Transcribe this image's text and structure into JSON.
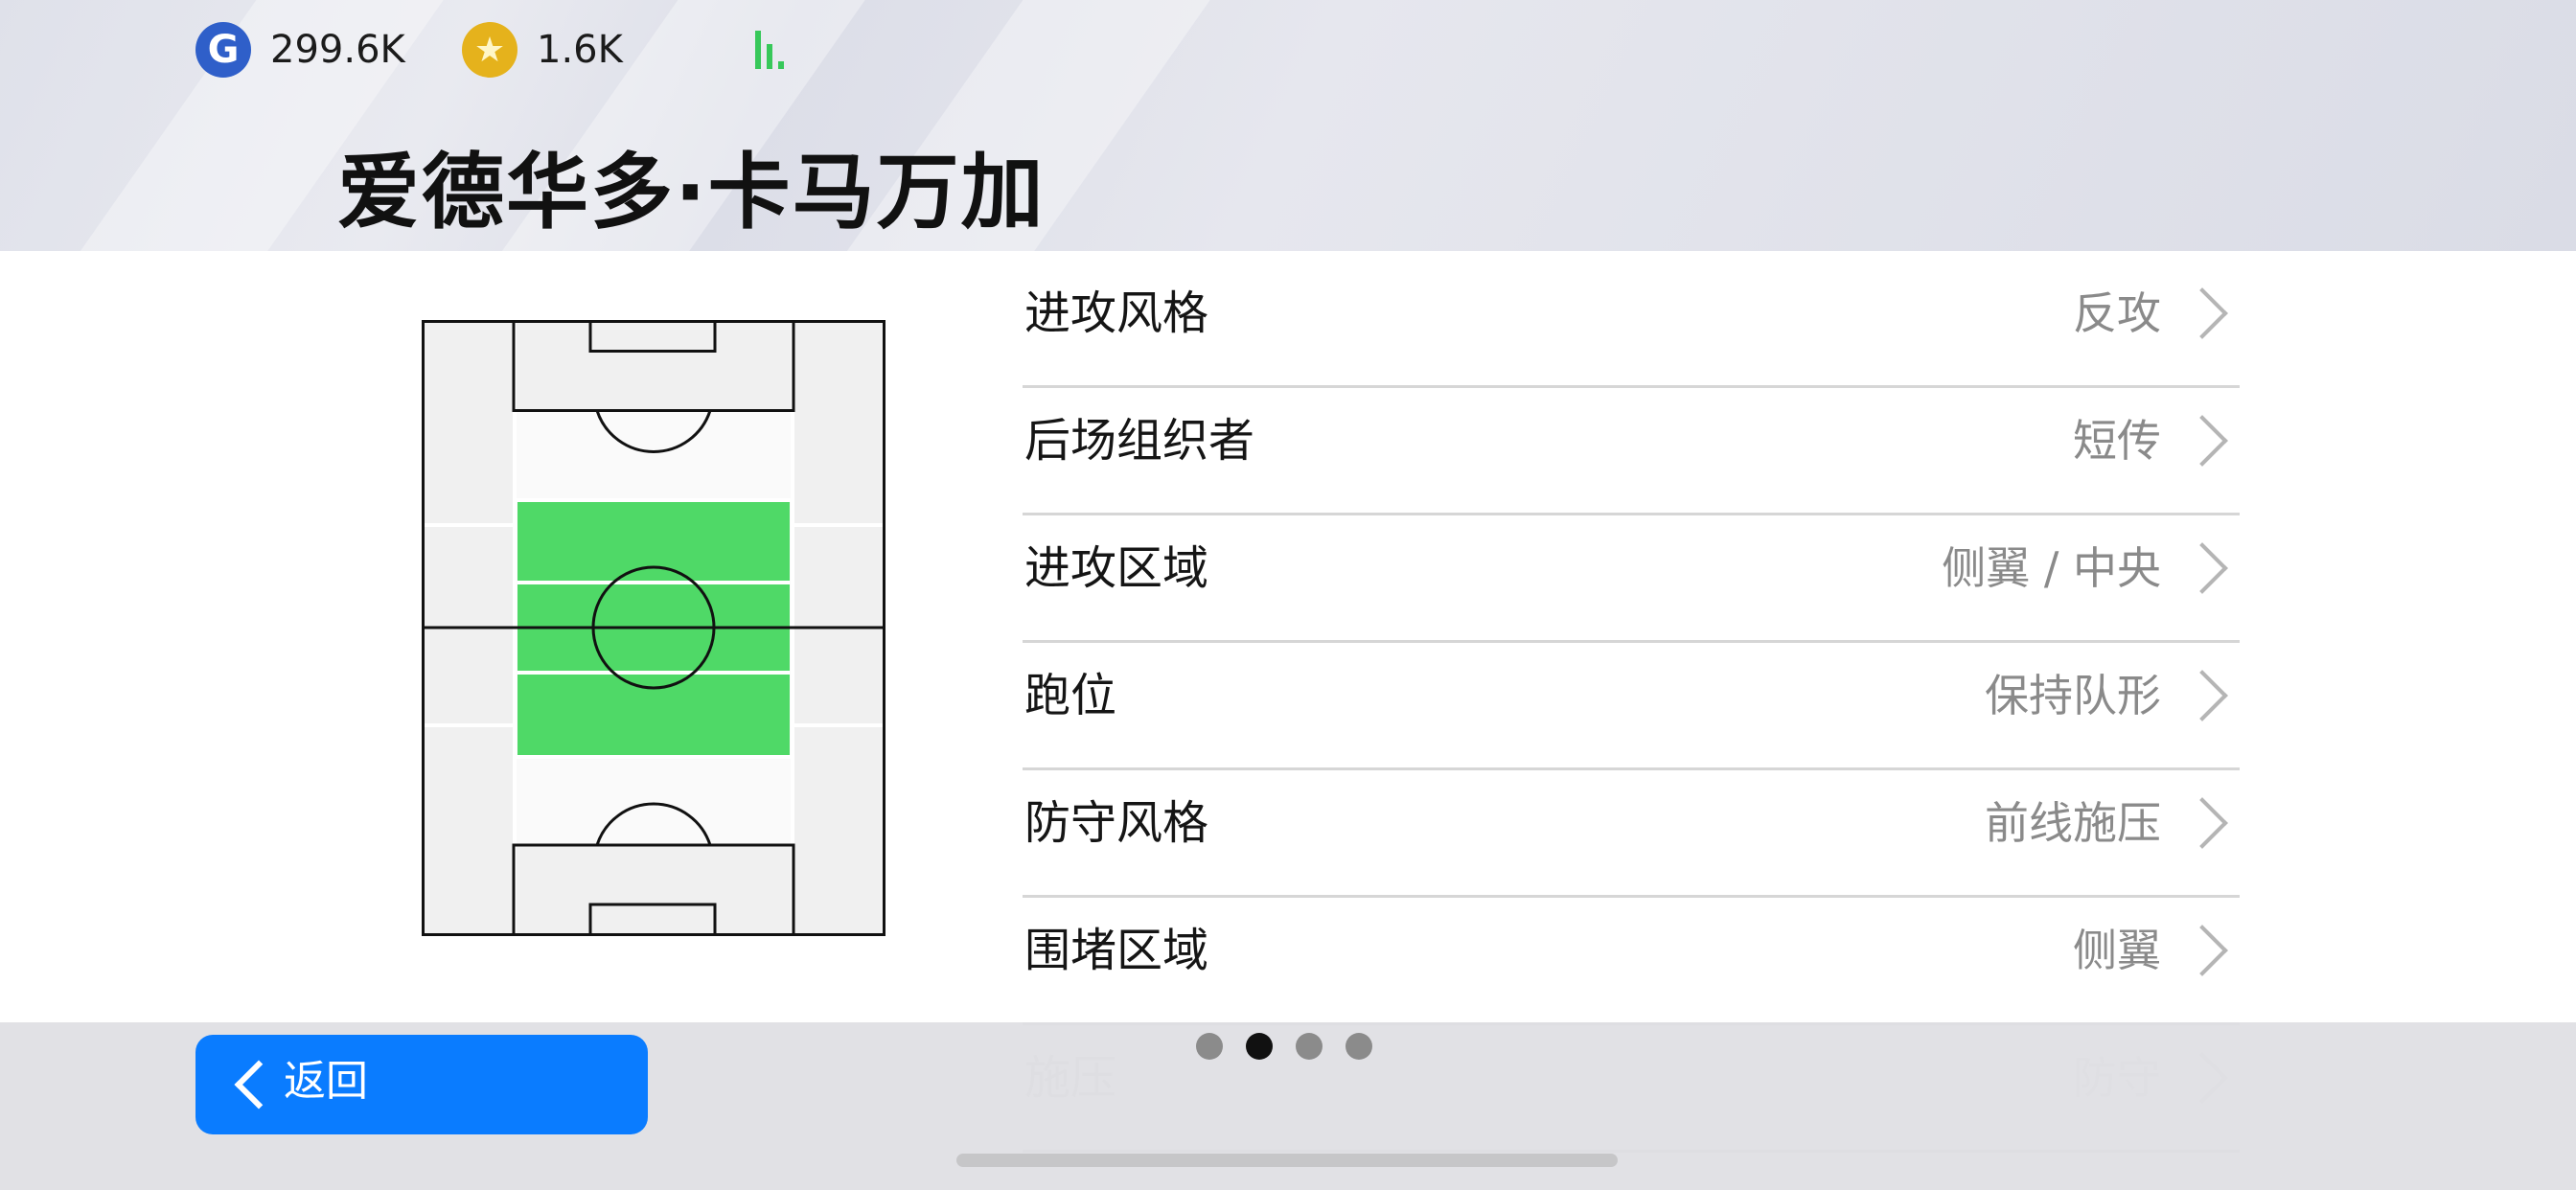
{
  "currencies": {
    "gp": {
      "icon": "g-coin-icon",
      "glyph": "G",
      "value": "299.6K"
    },
    "coins": {
      "icon": "star-coin-icon",
      "glyph": "★",
      "value": "1.6K"
    }
  },
  "signal_icon": "signal-bars-icon",
  "player_name": "爱德华多·卡马万加",
  "pitch": {
    "colors": {
      "pitch_fill": "#f0f0f0",
      "highlight": "#4fd967",
      "lines": "#111111"
    }
  },
  "settings": [
    {
      "label": "进攻风格",
      "value": "反攻"
    },
    {
      "label": "后场组织者",
      "value": "短传"
    },
    {
      "label": "进攻区域",
      "value": "侧翼 / 中央"
    },
    {
      "label": "跑位",
      "value": "保持队形"
    },
    {
      "label": "防守风格",
      "value": "前线施压"
    },
    {
      "label": "围堵区域",
      "value": "侧翼"
    },
    {
      "label": "施压",
      "value": "防守"
    }
  ],
  "back_button": {
    "label": "返回"
  },
  "pagination": {
    "total": 4,
    "active_index": 1
  },
  "colors": {
    "accent": "#0a7cff",
    "highlight_green": "#4fd967"
  }
}
